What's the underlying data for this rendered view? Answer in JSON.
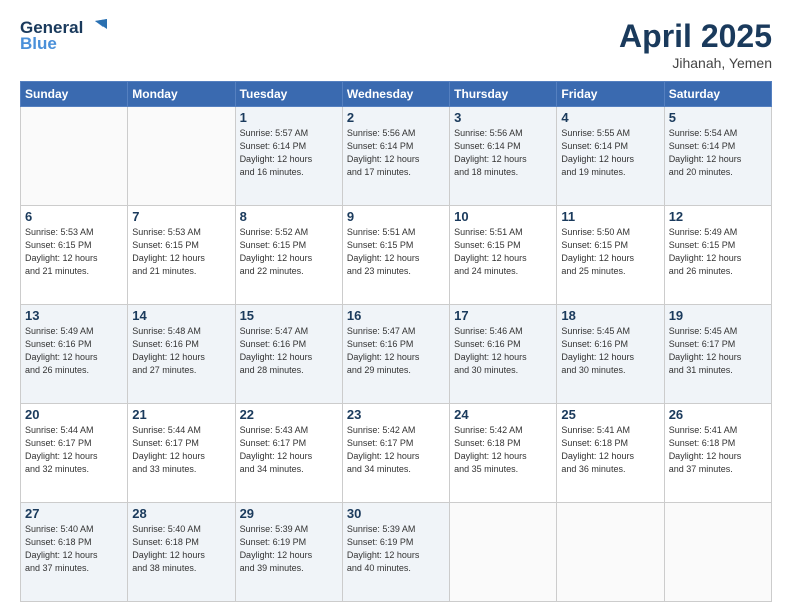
{
  "header": {
    "logo_line1": "General",
    "logo_line2": "Blue",
    "month_title": "April 2025",
    "location": "Jihanah, Yemen"
  },
  "weekdays": [
    "Sunday",
    "Monday",
    "Tuesday",
    "Wednesday",
    "Thursday",
    "Friday",
    "Saturday"
  ],
  "rows": [
    [
      {
        "day": "",
        "info": ""
      },
      {
        "day": "",
        "info": ""
      },
      {
        "day": "1",
        "info": "Sunrise: 5:57 AM\nSunset: 6:14 PM\nDaylight: 12 hours\nand 16 minutes."
      },
      {
        "day": "2",
        "info": "Sunrise: 5:56 AM\nSunset: 6:14 PM\nDaylight: 12 hours\nand 17 minutes."
      },
      {
        "day": "3",
        "info": "Sunrise: 5:56 AM\nSunset: 6:14 PM\nDaylight: 12 hours\nand 18 minutes."
      },
      {
        "day": "4",
        "info": "Sunrise: 5:55 AM\nSunset: 6:14 PM\nDaylight: 12 hours\nand 19 minutes."
      },
      {
        "day": "5",
        "info": "Sunrise: 5:54 AM\nSunset: 6:14 PM\nDaylight: 12 hours\nand 20 minutes."
      }
    ],
    [
      {
        "day": "6",
        "info": "Sunrise: 5:53 AM\nSunset: 6:15 PM\nDaylight: 12 hours\nand 21 minutes."
      },
      {
        "day": "7",
        "info": "Sunrise: 5:53 AM\nSunset: 6:15 PM\nDaylight: 12 hours\nand 21 minutes."
      },
      {
        "day": "8",
        "info": "Sunrise: 5:52 AM\nSunset: 6:15 PM\nDaylight: 12 hours\nand 22 minutes."
      },
      {
        "day": "9",
        "info": "Sunrise: 5:51 AM\nSunset: 6:15 PM\nDaylight: 12 hours\nand 23 minutes."
      },
      {
        "day": "10",
        "info": "Sunrise: 5:51 AM\nSunset: 6:15 PM\nDaylight: 12 hours\nand 24 minutes."
      },
      {
        "day": "11",
        "info": "Sunrise: 5:50 AM\nSunset: 6:15 PM\nDaylight: 12 hours\nand 25 minutes."
      },
      {
        "day": "12",
        "info": "Sunrise: 5:49 AM\nSunset: 6:15 PM\nDaylight: 12 hours\nand 26 minutes."
      }
    ],
    [
      {
        "day": "13",
        "info": "Sunrise: 5:49 AM\nSunset: 6:16 PM\nDaylight: 12 hours\nand 26 minutes."
      },
      {
        "day": "14",
        "info": "Sunrise: 5:48 AM\nSunset: 6:16 PM\nDaylight: 12 hours\nand 27 minutes."
      },
      {
        "day": "15",
        "info": "Sunrise: 5:47 AM\nSunset: 6:16 PM\nDaylight: 12 hours\nand 28 minutes."
      },
      {
        "day": "16",
        "info": "Sunrise: 5:47 AM\nSunset: 6:16 PM\nDaylight: 12 hours\nand 29 minutes."
      },
      {
        "day": "17",
        "info": "Sunrise: 5:46 AM\nSunset: 6:16 PM\nDaylight: 12 hours\nand 30 minutes."
      },
      {
        "day": "18",
        "info": "Sunrise: 5:45 AM\nSunset: 6:16 PM\nDaylight: 12 hours\nand 30 minutes."
      },
      {
        "day": "19",
        "info": "Sunrise: 5:45 AM\nSunset: 6:17 PM\nDaylight: 12 hours\nand 31 minutes."
      }
    ],
    [
      {
        "day": "20",
        "info": "Sunrise: 5:44 AM\nSunset: 6:17 PM\nDaylight: 12 hours\nand 32 minutes."
      },
      {
        "day": "21",
        "info": "Sunrise: 5:44 AM\nSunset: 6:17 PM\nDaylight: 12 hours\nand 33 minutes."
      },
      {
        "day": "22",
        "info": "Sunrise: 5:43 AM\nSunset: 6:17 PM\nDaylight: 12 hours\nand 34 minutes."
      },
      {
        "day": "23",
        "info": "Sunrise: 5:42 AM\nSunset: 6:17 PM\nDaylight: 12 hours\nand 34 minutes."
      },
      {
        "day": "24",
        "info": "Sunrise: 5:42 AM\nSunset: 6:18 PM\nDaylight: 12 hours\nand 35 minutes."
      },
      {
        "day": "25",
        "info": "Sunrise: 5:41 AM\nSunset: 6:18 PM\nDaylight: 12 hours\nand 36 minutes."
      },
      {
        "day": "26",
        "info": "Sunrise: 5:41 AM\nSunset: 6:18 PM\nDaylight: 12 hours\nand 37 minutes."
      }
    ],
    [
      {
        "day": "27",
        "info": "Sunrise: 5:40 AM\nSunset: 6:18 PM\nDaylight: 12 hours\nand 37 minutes."
      },
      {
        "day": "28",
        "info": "Sunrise: 5:40 AM\nSunset: 6:18 PM\nDaylight: 12 hours\nand 38 minutes."
      },
      {
        "day": "29",
        "info": "Sunrise: 5:39 AM\nSunset: 6:19 PM\nDaylight: 12 hours\nand 39 minutes."
      },
      {
        "day": "30",
        "info": "Sunrise: 5:39 AM\nSunset: 6:19 PM\nDaylight: 12 hours\nand 40 minutes."
      },
      {
        "day": "",
        "info": ""
      },
      {
        "day": "",
        "info": ""
      },
      {
        "day": "",
        "info": ""
      }
    ]
  ]
}
